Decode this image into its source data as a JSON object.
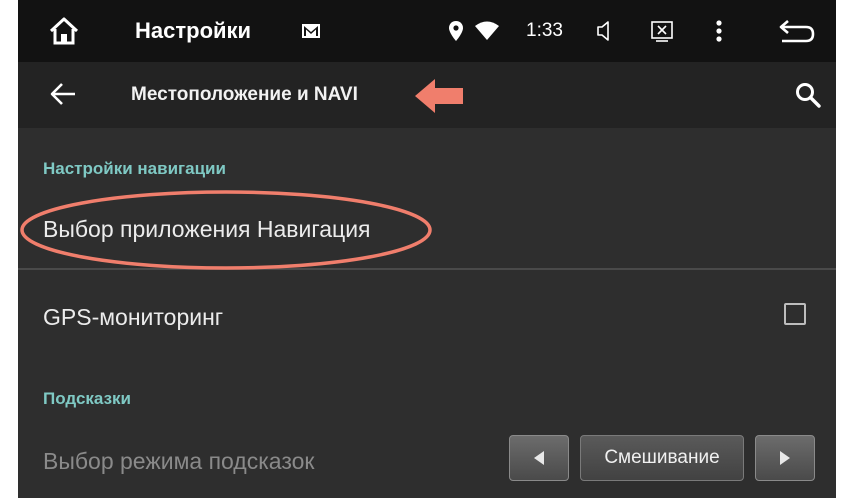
{
  "status_bar": {
    "title": "Настройки",
    "time": "1:33",
    "icons": [
      "home-icon",
      "gmail-icon",
      "location-icon",
      "wifi-icon",
      "volume-icon",
      "close-window-icon",
      "overflow-menu-icon",
      "back-icon"
    ]
  },
  "toolbar": {
    "title": "Местоположение и NAVI",
    "icons": [
      "back-arrow-icon",
      "search-icon"
    ]
  },
  "sections": [
    {
      "header": "Настройки навигации",
      "items": [
        {
          "title": "Выбор приложения Навигация"
        },
        {
          "title": "GPS-мониторинг",
          "checked": false
        }
      ]
    },
    {
      "header": "Подсказки",
      "items": [
        {
          "title": "Выбор режима подсказок",
          "enabled": false,
          "value": "Смешивание"
        }
      ]
    }
  ],
  "colors": {
    "accent": "#7fc9c4",
    "annotation": "#f07e6c",
    "background": "#2e2e2e"
  }
}
